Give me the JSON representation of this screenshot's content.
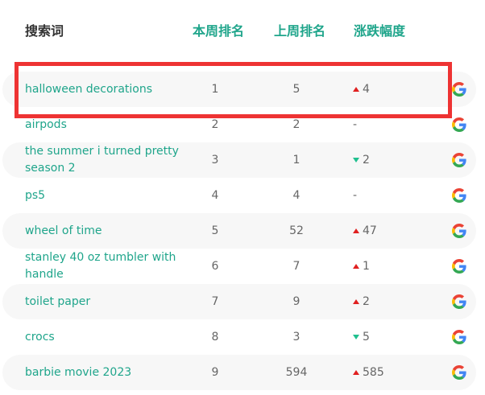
{
  "header": {
    "keyword": "搜索词",
    "this_week": "本周排名",
    "last_week": "上周排名",
    "change": "涨跌幅度"
  },
  "rows": [
    {
      "keyword": "halloween decorations",
      "this_week": "1",
      "last_week": "5",
      "trend": "up",
      "change": "4"
    },
    {
      "keyword": "airpods",
      "this_week": "2",
      "last_week": "2",
      "trend": "none",
      "change": "-"
    },
    {
      "keyword": "the summer i turned pretty season 2",
      "this_week": "3",
      "last_week": "1",
      "trend": "down",
      "change": "2"
    },
    {
      "keyword": "ps5",
      "this_week": "4",
      "last_week": "4",
      "trend": "none",
      "change": "-"
    },
    {
      "keyword": "wheel of time",
      "this_week": "5",
      "last_week": "52",
      "trend": "up",
      "change": "47"
    },
    {
      "keyword": "stanley 40 oz tumbler with handle",
      "this_week": "6",
      "last_week": "7",
      "trend": "up",
      "change": "1"
    },
    {
      "keyword": "toilet paper",
      "this_week": "7",
      "last_week": "9",
      "trend": "up",
      "change": "2"
    },
    {
      "keyword": "crocs",
      "this_week": "8",
      "last_week": "3",
      "trend": "down",
      "change": "5"
    },
    {
      "keyword": "barbie movie 2023",
      "this_week": "9",
      "last_week": "594",
      "trend": "up",
      "change": "585"
    }
  ],
  "icons": {
    "search_engine": "google-icon"
  },
  "colors": {
    "accent": "#1fa58b",
    "up": "#e02020",
    "down": "#1fc08e",
    "highlight": "#ee3333"
  }
}
